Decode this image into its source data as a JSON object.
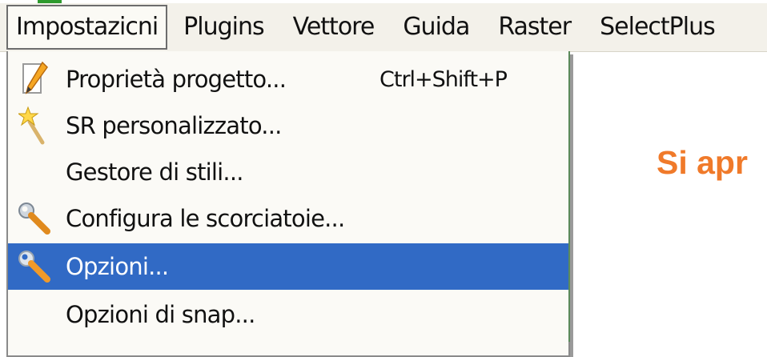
{
  "menubar": {
    "items": [
      {
        "label": "Impostazicni",
        "active": true
      },
      {
        "label": "Plugins"
      },
      {
        "label": "Vettore"
      },
      {
        "label": "Guida"
      },
      {
        "label": "Raster"
      },
      {
        "label": "SelectPlus"
      }
    ]
  },
  "dropdown": {
    "items": [
      {
        "label": "Proprietà progetto...",
        "shortcut": "Ctrl+Shift+P",
        "icon": "pencil-icon"
      },
      {
        "label": "SR personalizzato...",
        "shortcut": "",
        "icon": "magic-wand-icon"
      },
      {
        "label": "Gestore di stili...",
        "shortcut": "",
        "icon": ""
      },
      {
        "label": "Configura le scorciatoie...",
        "shortcut": "",
        "icon": "wrench-icon"
      },
      {
        "label": "Opzioni...",
        "shortcut": "",
        "icon": "wrench-icon",
        "highlighted": true
      },
      {
        "label": "Opzioni di snap...",
        "shortcut": "",
        "icon": ""
      }
    ]
  },
  "caption": {
    "text": "Si apr"
  },
  "colors": {
    "highlight": "#316ac5",
    "caption": "#f07a2a",
    "menubar_bg": "#f3f1ea",
    "dropdown_bg": "#fbfaf6"
  }
}
